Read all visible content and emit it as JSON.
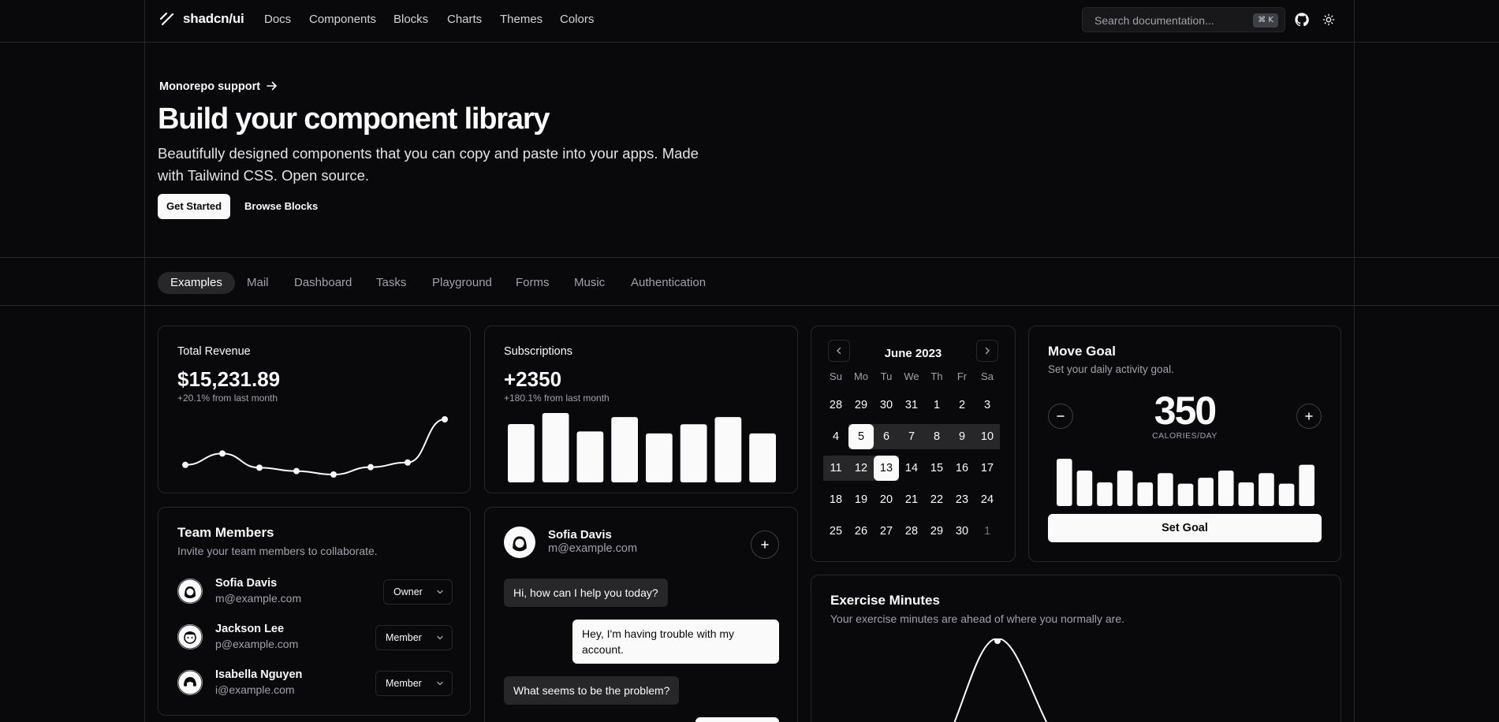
{
  "header": {
    "logo_text": "shadcn/ui",
    "nav": [
      "Docs",
      "Components",
      "Blocks",
      "Charts",
      "Themes",
      "Colors"
    ],
    "search_placeholder": "Search documentation...",
    "search_shortcut": "⌘ K",
    "github_icon": "github-icon",
    "theme_icon": "sun-icon"
  },
  "hero": {
    "announcement": "Monorepo support",
    "title": "Build your component library",
    "subtitle": "Beautifully designed components that you can copy and paste into your apps. Made with Tailwind CSS. Open source.",
    "primary_button": "Get Started",
    "secondary_button": "Browse Blocks"
  },
  "tabs": [
    "Examples",
    "Mail",
    "Dashboard",
    "Tasks",
    "Playground",
    "Forms",
    "Music",
    "Authentication"
  ],
  "active_tab": "Examples",
  "revenue": {
    "label": "Total Revenue",
    "value": "$15,231.89",
    "change": "+20.1% from last month",
    "chart_data": {
      "type": "line",
      "values": [
        10400,
        14405,
        9400,
        8200,
        7000,
        9600,
        11244,
        26475
      ]
    }
  },
  "subscriptions": {
    "label": "Subscriptions",
    "value": "+2350",
    "change": "+180.1% from last month",
    "chart_data": {
      "type": "bar",
      "values": [
        240,
        300,
        200,
        278,
        189,
        239,
        278,
        189
      ]
    }
  },
  "calendar": {
    "month": "June 2023",
    "weekdays": [
      "Su",
      "Mo",
      "Tu",
      "We",
      "Th",
      "Fr",
      "Sa"
    ],
    "weeks": [
      [
        "28",
        "29",
        "30",
        "31",
        "1",
        "2",
        "3"
      ],
      [
        "4",
        "5",
        "6",
        "7",
        "8",
        "9",
        "10"
      ],
      [
        "11",
        "12",
        "13",
        "14",
        "15",
        "16",
        "17"
      ],
      [
        "18",
        "19",
        "20",
        "21",
        "22",
        "23",
        "24"
      ],
      [
        "25",
        "26",
        "27",
        "28",
        "29",
        "30",
        "1"
      ]
    ],
    "range_start": "5",
    "range_end": "13"
  },
  "move_goal": {
    "title": "Move Goal",
    "description": "Set your daily activity goal.",
    "value": "350",
    "unit": "CALORIES/DAY",
    "button": "Set Goal",
    "chart_data": {
      "type": "bar",
      "values": [
        400,
        300,
        200,
        300,
        200,
        278,
        189,
        239,
        300,
        200,
        278,
        189,
        349
      ]
    }
  },
  "team": {
    "title": "Team Members",
    "description": "Invite your team members to collaborate.",
    "members": [
      {
        "name": "Sofia Davis",
        "email": "m@example.com",
        "role": "Owner"
      },
      {
        "name": "Jackson Lee",
        "email": "p@example.com",
        "role": "Member"
      },
      {
        "name": "Isabella Nguyen",
        "email": "i@example.com",
        "role": "Member"
      }
    ]
  },
  "chat": {
    "name": "Sofia Davis",
    "email": "m@example.com",
    "messages": [
      {
        "from": "them",
        "text": "Hi, how can I help you today?"
      },
      {
        "from": "me",
        "text": "Hey, I'm having trouble with my account."
      },
      {
        "from": "them",
        "text": "What seems to be the problem?"
      }
    ]
  },
  "exercise": {
    "title": "Exercise Minutes",
    "description": "Your exercise minutes are ahead of where you normally are."
  }
}
